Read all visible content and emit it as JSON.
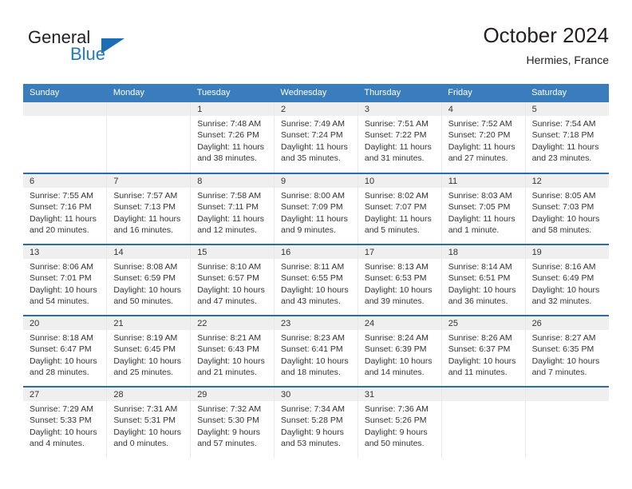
{
  "brand": {
    "name_part1": "General",
    "name_part2": "Blue",
    "triangle_icon": "blue-triangle-icon",
    "color_dark": "#231f20",
    "color_blue": "#1f7bc1"
  },
  "header": {
    "title": "October 2024",
    "subtitle": "Hermies, France"
  },
  "theme": {
    "header_blue": "#3a7dbf",
    "row_divider_blue": "#2e6da4",
    "date_band_gray": "#efefef",
    "text": "#333333"
  },
  "weekday_headers": [
    "Sunday",
    "Monday",
    "Tuesday",
    "Wednesday",
    "Thursday",
    "Friday",
    "Saturday"
  ],
  "labels": {
    "sunrise": "Sunrise:",
    "sunset": "Sunset:",
    "daylight": "Daylight:"
  },
  "weeks": [
    [
      {
        "date": "",
        "sunrise": "",
        "sunset": "",
        "daylight_line1": "",
        "daylight_line2": ""
      },
      {
        "date": "",
        "sunrise": "",
        "sunset": "",
        "daylight_line1": "",
        "daylight_line2": ""
      },
      {
        "date": "1",
        "sunrise": "Sunrise: 7:48 AM",
        "sunset": "Sunset: 7:26 PM",
        "daylight_line1": "Daylight: 11 hours",
        "daylight_line2": "and 38 minutes."
      },
      {
        "date": "2",
        "sunrise": "Sunrise: 7:49 AM",
        "sunset": "Sunset: 7:24 PM",
        "daylight_line1": "Daylight: 11 hours",
        "daylight_line2": "and 35 minutes."
      },
      {
        "date": "3",
        "sunrise": "Sunrise: 7:51 AM",
        "sunset": "Sunset: 7:22 PM",
        "daylight_line1": "Daylight: 11 hours",
        "daylight_line2": "and 31 minutes."
      },
      {
        "date": "4",
        "sunrise": "Sunrise: 7:52 AM",
        "sunset": "Sunset: 7:20 PM",
        "daylight_line1": "Daylight: 11 hours",
        "daylight_line2": "and 27 minutes."
      },
      {
        "date": "5",
        "sunrise": "Sunrise: 7:54 AM",
        "sunset": "Sunset: 7:18 PM",
        "daylight_line1": "Daylight: 11 hours",
        "daylight_line2": "and 23 minutes."
      }
    ],
    [
      {
        "date": "6",
        "sunrise": "Sunrise: 7:55 AM",
        "sunset": "Sunset: 7:16 PM",
        "daylight_line1": "Daylight: 11 hours",
        "daylight_line2": "and 20 minutes."
      },
      {
        "date": "7",
        "sunrise": "Sunrise: 7:57 AM",
        "sunset": "Sunset: 7:13 PM",
        "daylight_line1": "Daylight: 11 hours",
        "daylight_line2": "and 16 minutes."
      },
      {
        "date": "8",
        "sunrise": "Sunrise: 7:58 AM",
        "sunset": "Sunset: 7:11 PM",
        "daylight_line1": "Daylight: 11 hours",
        "daylight_line2": "and 12 minutes."
      },
      {
        "date": "9",
        "sunrise": "Sunrise: 8:00 AM",
        "sunset": "Sunset: 7:09 PM",
        "daylight_line1": "Daylight: 11 hours",
        "daylight_line2": "and 9 minutes."
      },
      {
        "date": "10",
        "sunrise": "Sunrise: 8:02 AM",
        "sunset": "Sunset: 7:07 PM",
        "daylight_line1": "Daylight: 11 hours",
        "daylight_line2": "and 5 minutes."
      },
      {
        "date": "11",
        "sunrise": "Sunrise: 8:03 AM",
        "sunset": "Sunset: 7:05 PM",
        "daylight_line1": "Daylight: 11 hours",
        "daylight_line2": "and 1 minute."
      },
      {
        "date": "12",
        "sunrise": "Sunrise: 8:05 AM",
        "sunset": "Sunset: 7:03 PM",
        "daylight_line1": "Daylight: 10 hours",
        "daylight_line2": "and 58 minutes."
      }
    ],
    [
      {
        "date": "13",
        "sunrise": "Sunrise: 8:06 AM",
        "sunset": "Sunset: 7:01 PM",
        "daylight_line1": "Daylight: 10 hours",
        "daylight_line2": "and 54 minutes."
      },
      {
        "date": "14",
        "sunrise": "Sunrise: 8:08 AM",
        "sunset": "Sunset: 6:59 PM",
        "daylight_line1": "Daylight: 10 hours",
        "daylight_line2": "and 50 minutes."
      },
      {
        "date": "15",
        "sunrise": "Sunrise: 8:10 AM",
        "sunset": "Sunset: 6:57 PM",
        "daylight_line1": "Daylight: 10 hours",
        "daylight_line2": "and 47 minutes."
      },
      {
        "date": "16",
        "sunrise": "Sunrise: 8:11 AM",
        "sunset": "Sunset: 6:55 PM",
        "daylight_line1": "Daylight: 10 hours",
        "daylight_line2": "and 43 minutes."
      },
      {
        "date": "17",
        "sunrise": "Sunrise: 8:13 AM",
        "sunset": "Sunset: 6:53 PM",
        "daylight_line1": "Daylight: 10 hours",
        "daylight_line2": "and 39 minutes."
      },
      {
        "date": "18",
        "sunrise": "Sunrise: 8:14 AM",
        "sunset": "Sunset: 6:51 PM",
        "daylight_line1": "Daylight: 10 hours",
        "daylight_line2": "and 36 minutes."
      },
      {
        "date": "19",
        "sunrise": "Sunrise: 8:16 AM",
        "sunset": "Sunset: 6:49 PM",
        "daylight_line1": "Daylight: 10 hours",
        "daylight_line2": "and 32 minutes."
      }
    ],
    [
      {
        "date": "20",
        "sunrise": "Sunrise: 8:18 AM",
        "sunset": "Sunset: 6:47 PM",
        "daylight_line1": "Daylight: 10 hours",
        "daylight_line2": "and 28 minutes."
      },
      {
        "date": "21",
        "sunrise": "Sunrise: 8:19 AM",
        "sunset": "Sunset: 6:45 PM",
        "daylight_line1": "Daylight: 10 hours",
        "daylight_line2": "and 25 minutes."
      },
      {
        "date": "22",
        "sunrise": "Sunrise: 8:21 AM",
        "sunset": "Sunset: 6:43 PM",
        "daylight_line1": "Daylight: 10 hours",
        "daylight_line2": "and 21 minutes."
      },
      {
        "date": "23",
        "sunrise": "Sunrise: 8:23 AM",
        "sunset": "Sunset: 6:41 PM",
        "daylight_line1": "Daylight: 10 hours",
        "daylight_line2": "and 18 minutes."
      },
      {
        "date": "24",
        "sunrise": "Sunrise: 8:24 AM",
        "sunset": "Sunset: 6:39 PM",
        "daylight_line1": "Daylight: 10 hours",
        "daylight_line2": "and 14 minutes."
      },
      {
        "date": "25",
        "sunrise": "Sunrise: 8:26 AM",
        "sunset": "Sunset: 6:37 PM",
        "daylight_line1": "Daylight: 10 hours",
        "daylight_line2": "and 11 minutes."
      },
      {
        "date": "26",
        "sunrise": "Sunrise: 8:27 AM",
        "sunset": "Sunset: 6:35 PM",
        "daylight_line1": "Daylight: 10 hours",
        "daylight_line2": "and 7 minutes."
      }
    ],
    [
      {
        "date": "27",
        "sunrise": "Sunrise: 7:29 AM",
        "sunset": "Sunset: 5:33 PM",
        "daylight_line1": "Daylight: 10 hours",
        "daylight_line2": "and 4 minutes."
      },
      {
        "date": "28",
        "sunrise": "Sunrise: 7:31 AM",
        "sunset": "Sunset: 5:31 PM",
        "daylight_line1": "Daylight: 10 hours",
        "daylight_line2": "and 0 minutes."
      },
      {
        "date": "29",
        "sunrise": "Sunrise: 7:32 AM",
        "sunset": "Sunset: 5:30 PM",
        "daylight_line1": "Daylight: 9 hours",
        "daylight_line2": "and 57 minutes."
      },
      {
        "date": "30",
        "sunrise": "Sunrise: 7:34 AM",
        "sunset": "Sunset: 5:28 PM",
        "daylight_line1": "Daylight: 9 hours",
        "daylight_line2": "and 53 minutes."
      },
      {
        "date": "31",
        "sunrise": "Sunrise: 7:36 AM",
        "sunset": "Sunset: 5:26 PM",
        "daylight_line1": "Daylight: 9 hours",
        "daylight_line2": "and 50 minutes."
      },
      {
        "date": "",
        "sunrise": "",
        "sunset": "",
        "daylight_line1": "",
        "daylight_line2": ""
      },
      {
        "date": "",
        "sunrise": "",
        "sunset": "",
        "daylight_line1": "",
        "daylight_line2": ""
      }
    ]
  ]
}
